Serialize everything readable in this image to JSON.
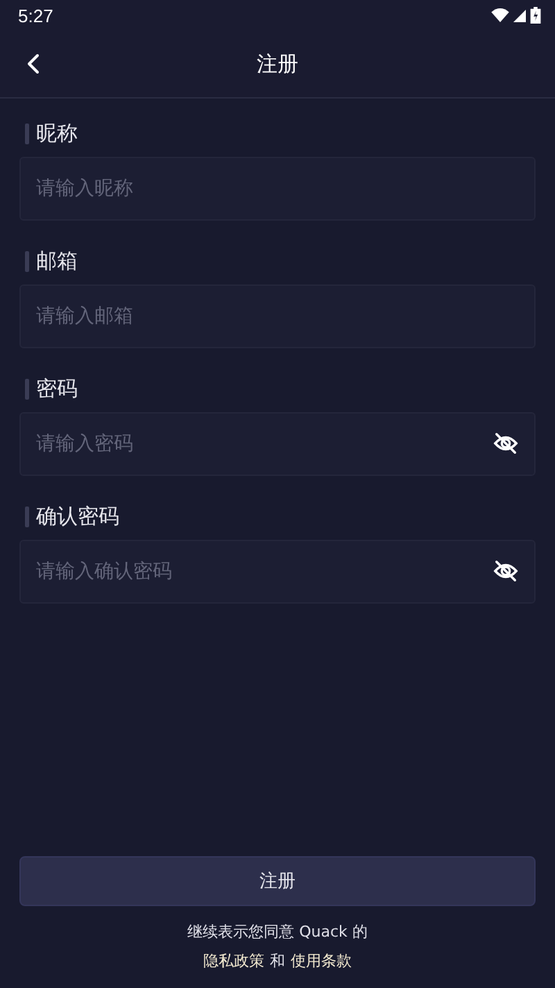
{
  "status_bar": {
    "time": "5:27"
  },
  "header": {
    "title": "注册"
  },
  "fields": [
    {
      "label": "昵称",
      "placeholder": "请输入昵称",
      "kind": "text"
    },
    {
      "label": "邮箱",
      "placeholder": "请输入邮箱",
      "kind": "text"
    },
    {
      "label": "密码",
      "placeholder": "请输入密码",
      "kind": "password"
    },
    {
      "label": "确认密码",
      "placeholder": "请输入确认密码",
      "kind": "password"
    }
  ],
  "submit_button": "注册",
  "terms": {
    "text": "继续表示您同意 Quack 的",
    "links": [
      "隐私政策",
      "使用条款"
    ],
    "joiner": "和"
  }
}
